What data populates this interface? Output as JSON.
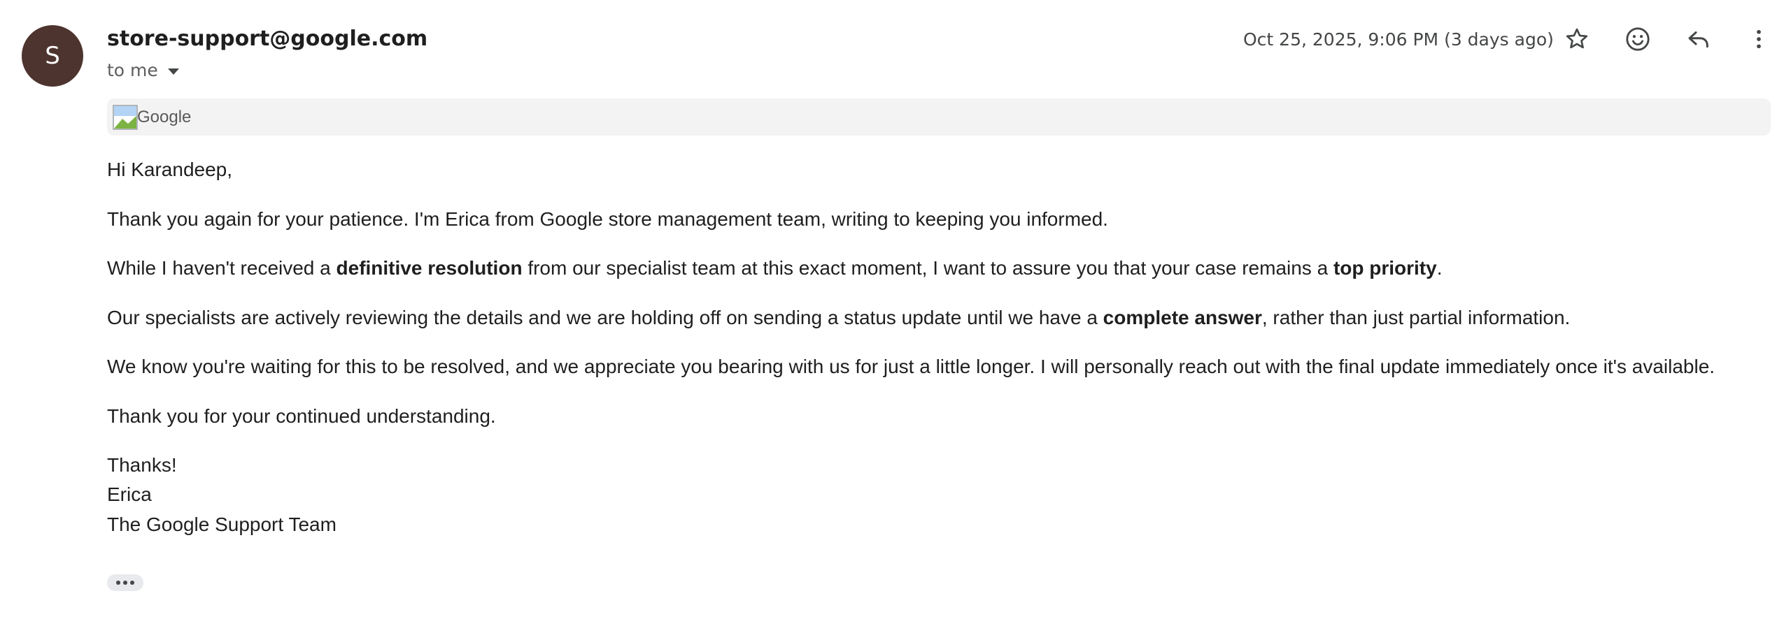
{
  "sender": {
    "avatar_letter": "S",
    "avatar_color": "#4e342e",
    "email": "store-support@google.com",
    "to_label": "to me"
  },
  "header": {
    "date": "Oct 25, 2025, 9:06 PM (3 days ago)",
    "icons": [
      "star-icon",
      "emoji-icon",
      "reply-icon",
      "more-vert-icon"
    ]
  },
  "logo": {
    "alt": "Google"
  },
  "body": {
    "greeting": "Hi Karandeep,",
    "p1": "Thank you again for your patience. I'm Erica from Google store management team, writing to keeping you informed.",
    "p2": {
      "a": "While I haven't received a ",
      "b1": "definitive resolution",
      "c": " from our specialist team at this exact moment, I want to assure you that your case remains a ",
      "b2": "top priority",
      "d": "."
    },
    "p3": {
      "a": "Our specialists are actively reviewing the details and we are holding off on sending a status update until we have a ",
      "b1": "complete answer",
      "c": ", rather than just partial information."
    },
    "p4": "We know you're waiting for this to be resolved, and we appreciate you bearing with us for just a little longer. I will personally reach out with the final update immediately once it's available.",
    "p5": "Thank you for your continued understanding.",
    "signoff": "Thanks!",
    "signer": "Erica",
    "team": "The Google Support Team"
  }
}
